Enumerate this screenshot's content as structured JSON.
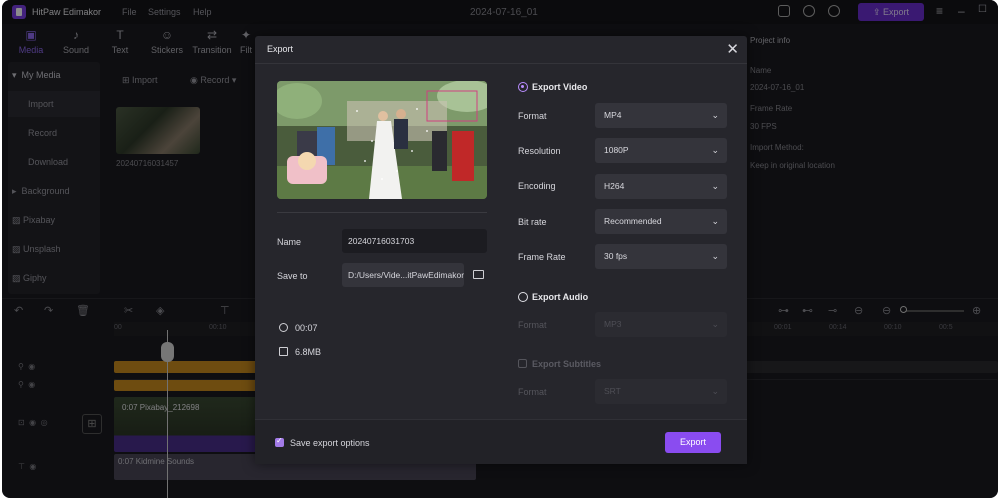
{
  "app": {
    "name": "HitPaw Edimakor",
    "project_name": "2024-07-16_01",
    "menu": [
      "File",
      "Settings",
      "Help"
    ],
    "export_label": "Export",
    "accent": "#7b3fe4"
  },
  "toolbar": {
    "tools": [
      {
        "label": "Media",
        "icon": "media-icon"
      },
      {
        "label": "Sound",
        "icon": "music-note-icon"
      },
      {
        "label": "Text",
        "icon": "text-icon"
      },
      {
        "label": "Stickers",
        "icon": "sticker-icon"
      },
      {
        "label": "Transition",
        "icon": "transition-icon"
      },
      {
        "label": "Filt",
        "icon": "filter-icon"
      }
    ]
  },
  "sidebar": {
    "header": "My Media",
    "items": [
      "Import",
      "Record",
      "Download",
      "Background",
      "Pixabay",
      "Unsplash",
      "Giphy"
    ]
  },
  "media": {
    "import_label": "Import",
    "record_label": "Record",
    "thumb_name": "20240716031457"
  },
  "project_info": {
    "title": "Project info",
    "name_label": "Name",
    "name_value": "2024-07-16_01",
    "frame_rate_label": "Frame Rate",
    "frame_rate_value": "30 FPS",
    "import_method_label": "Import Method:",
    "import_method_value": "Keep in original location"
  },
  "timeline": {
    "ruler_ticks": [
      "00",
      "00:10"
    ],
    "right_ticks": [
      "00:01",
      "00:14",
      "00:10",
      "00:5"
    ],
    "clip_label": "0:07  Pixabay_212698",
    "audio_label": "0:07  Kidmine Sounds"
  },
  "dialog": {
    "title": "Export",
    "name_label": "Name",
    "name_value": "20240716031703",
    "save_to_label": "Save to",
    "save_to_value": "D:/Users/Vide...itPawEdimakor",
    "duration": "00:07",
    "size": "6.8MB",
    "export_video_label": "Export Video",
    "format_label": "Format",
    "format_value": "MP4",
    "resolution_label": "Resolution",
    "resolution_value": "1080P",
    "encoding_label": "Encoding",
    "encoding_value": "H264",
    "bitrate_label": "Bit rate",
    "bitrate_value": "Recommended",
    "framerate_label": "Frame Rate",
    "framerate_value": "30  fps",
    "export_audio_label": "Export Audio",
    "audio_format_label": "Format",
    "audio_format_value": "MP3",
    "export_subtitles_label": "Export Subtitles",
    "sub_format_label": "Format",
    "sub_format_value": "SRT",
    "save_options_label": "Save export options",
    "export_button": "Export"
  }
}
